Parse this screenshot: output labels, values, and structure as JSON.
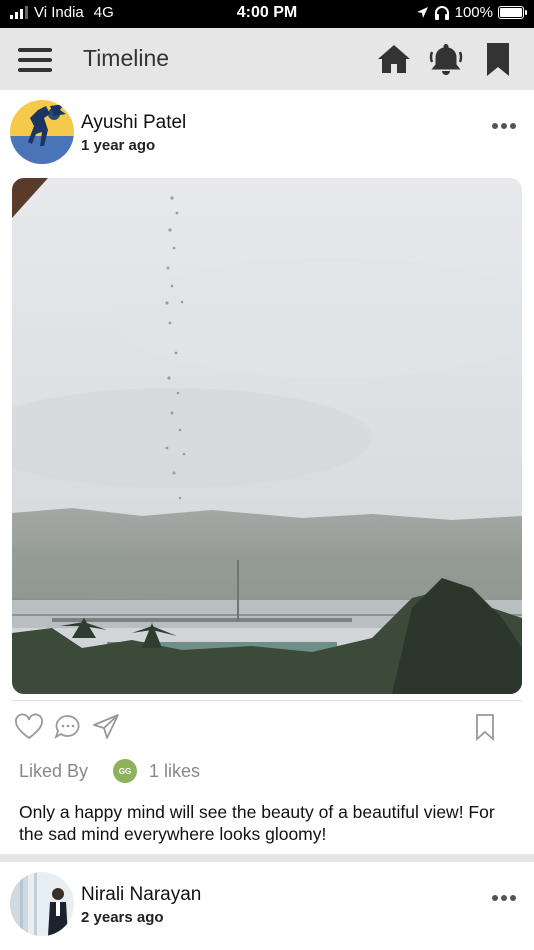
{
  "status_bar": {
    "carrier": "Vi India",
    "network": "4G",
    "time": "4:00 PM",
    "battery": "100%"
  },
  "header": {
    "title": "Timeline",
    "icons": [
      "menu-icon",
      "home-icon",
      "bell-icon",
      "bookmark-icon"
    ]
  },
  "posts": [
    {
      "author": "Ayushi Patel",
      "time_ago": "1 year ago",
      "liked_by_label": "Liked By",
      "liker_initials": "GG",
      "likes": "1 likes",
      "caption": "Only a happy mind will see the beauty of a beautiful view! For the sad mind everywhere looks gloomy!"
    },
    {
      "author": "Nirali Narayan",
      "time_ago": "2 years ago"
    }
  ],
  "colors": {
    "header_bg": "#e6e6e6",
    "icon_dark": "#333333",
    "muted_text": "#888888",
    "liker_badge": "#8cb35a"
  }
}
